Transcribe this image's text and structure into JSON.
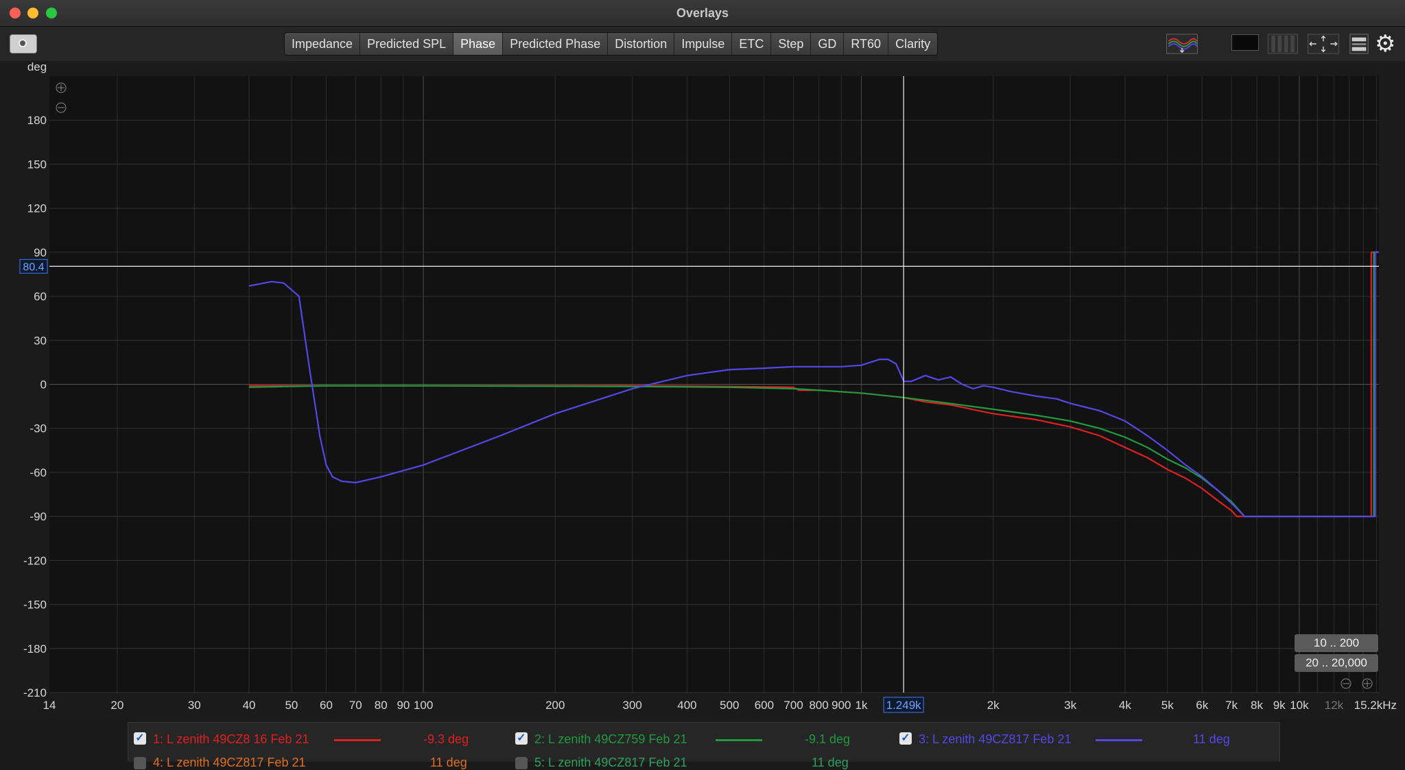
{
  "window": {
    "title": "Overlays"
  },
  "tabs": [
    "Impedance",
    "Predicted SPL",
    "Phase",
    "Predicted Phase",
    "Distortion",
    "Impulse",
    "ETC",
    "Step",
    "GD",
    "RT60",
    "Clarity"
  ],
  "active_tab": "Phase",
  "toolbar_icons": [
    "camera-icon",
    "overlay-waves-icon",
    "color-swatch-icon",
    "columns-icon",
    "fit-arrows-icon",
    "layout-icon",
    "gear-icon"
  ],
  "plot": {
    "y_unit_label": "deg",
    "cursor": {
      "y_readout": "80.4",
      "x_readout": "1.249k"
    },
    "range_buttons": [
      "10 .. 200",
      "20 .. 20,000"
    ]
  },
  "chart_data": {
    "type": "line",
    "xlabel": "",
    "ylabel": "deg",
    "x_scale": "log",
    "xlim": [
      14,
      15200
    ],
    "ylim": [
      -210,
      210
    ],
    "x_ticks": [
      {
        "v": 14,
        "label": "14"
      },
      {
        "v": 20,
        "label": "20"
      },
      {
        "v": 30,
        "label": "30"
      },
      {
        "v": 40,
        "label": "40"
      },
      {
        "v": 50,
        "label": "50"
      },
      {
        "v": 60,
        "label": "60"
      },
      {
        "v": 70,
        "label": "70"
      },
      {
        "v": 80,
        "label": "80"
      },
      {
        "v": 90,
        "label": "90"
      },
      {
        "v": 100,
        "label": "100"
      },
      {
        "v": 200,
        "label": "200"
      },
      {
        "v": 300,
        "label": "300"
      },
      {
        "v": 400,
        "label": "400"
      },
      {
        "v": 500,
        "label": "500"
      },
      {
        "v": 600,
        "label": "600"
      },
      {
        "v": 700,
        "label": "700"
      },
      {
        "v": 800,
        "label": "800"
      },
      {
        "v": 900,
        "label": "900"
      },
      {
        "v": 1000,
        "label": "1k"
      },
      {
        "v": 2000,
        "label": "2k"
      },
      {
        "v": 3000,
        "label": "3k"
      },
      {
        "v": 4000,
        "label": "4k"
      },
      {
        "v": 5000,
        "label": "5k"
      },
      {
        "v": 6000,
        "label": "6k"
      },
      {
        "v": 7000,
        "label": "7k"
      },
      {
        "v": 8000,
        "label": "8k"
      },
      {
        "v": 9000,
        "label": "9k"
      },
      {
        "v": 10000,
        "label": "10k"
      },
      {
        "v": 12000,
        "label": "12k"
      },
      {
        "v": 15200,
        "label": "15.2kHz"
      }
    ],
    "y_ticks": [
      180,
      150,
      120,
      90,
      60,
      30,
      0,
      -30,
      -60,
      -90,
      -120,
      -150,
      -180,
      -210
    ],
    "cursor": {
      "x": 1249,
      "y": 80.4
    },
    "series": [
      {
        "name": "1: L zenith 49CZ8 16 Feb 21",
        "color": "#e02020",
        "readout": "-9.3 deg",
        "x": [
          40,
          100,
          300,
          500,
          700,
          720,
          800,
          1000,
          1250,
          1400,
          1600,
          2000,
          2500,
          3000,
          3500,
          4000,
          4500,
          5000,
          5500,
          6000,
          6500,
          7000,
          7200,
          14600,
          14600,
          15200
        ],
        "y": [
          -1,
          -1,
          -1,
          -1.5,
          -2,
          -4,
          -4,
          -6,
          -9,
          -12,
          -14,
          -20,
          -24,
          -29,
          -35,
          -43,
          -50,
          -58,
          -64,
          -71,
          -79,
          -86,
          -90,
          -90,
          90,
          90
        ]
      },
      {
        "name": "2: L zenith 49CZ759 Feb 21",
        "color": "#1f9a3f",
        "readout": "-9.1 deg",
        "x": [
          40,
          60,
          100,
          300,
          500,
          700,
          800,
          1000,
          1250,
          1500,
          2000,
          2500,
          3000,
          3500,
          4000,
          4500,
          5000,
          5500,
          6000,
          6500,
          7000,
          7500,
          14800,
          14800,
          15200
        ],
        "y": [
          -2,
          -1,
          -1,
          -1.5,
          -2,
          -3,
          -4,
          -6,
          -9,
          -12,
          -17,
          -21,
          -25,
          -30,
          -36,
          -43,
          -51,
          -57,
          -64,
          -72,
          -80,
          -90,
          -90,
          90,
          90
        ]
      },
      {
        "name": "3: L zenith 49CZ817 Feb 21",
        "color": "#5548e8",
        "readout": "11 deg",
        "x": [
          40,
          45,
          48,
          52,
          55,
          57,
          58,
          60,
          62,
          65,
          70,
          80,
          100,
          150,
          200,
          300,
          400,
          500,
          600,
          700,
          800,
          900,
          1000,
          1100,
          1150,
          1200,
          1250,
          1300,
          1400,
          1500,
          1600,
          1700,
          1800,
          1900,
          2000,
          2200,
          2500,
          2800,
          3000,
          3500,
          4000,
          4500,
          5000,
          5500,
          6000,
          6500,
          7000,
          7500,
          7700,
          14900,
          14900,
          15200
        ],
        "y": [
          67,
          70,
          69,
          60,
          10,
          -20,
          -35,
          -55,
          -63,
          -66,
          -67,
          -63,
          -55,
          -35,
          -20,
          -3,
          6,
          10,
          11,
          12,
          12,
          12,
          13,
          17,
          17,
          14,
          2,
          2,
          6,
          3,
          5,
          0,
          -3,
          -1,
          -2,
          -5,
          -8,
          -10,
          -13,
          -18,
          -25,
          -35,
          -45,
          -55,
          -63,
          -72,
          -81,
          -90,
          -90,
          -90,
          90,
          90
        ]
      }
    ]
  },
  "legend": {
    "rows": [
      {
        "checked": true,
        "label": "1: L zenith 49CZ8 16 Feb 21",
        "color": "#e02020",
        "value": "-9.3 deg"
      },
      {
        "checked": true,
        "label": "2: L zenith 49CZ759 Feb 21",
        "color": "#1f9a3f",
        "value": "-9.1 deg"
      },
      {
        "checked": true,
        "label": "3: L zenith 49CZ817 Feb 21",
        "color": "#5548e8",
        "value": "11 deg"
      }
    ],
    "partial_rows": [
      {
        "label": "4: L zenith 49CZ817 Feb 21",
        "color": "#e07020",
        "value": "11 deg"
      },
      {
        "label": "5: L zenith 49CZ817 Feb 21",
        "color": "#2fa060",
        "value": "11 deg"
      }
    ]
  }
}
